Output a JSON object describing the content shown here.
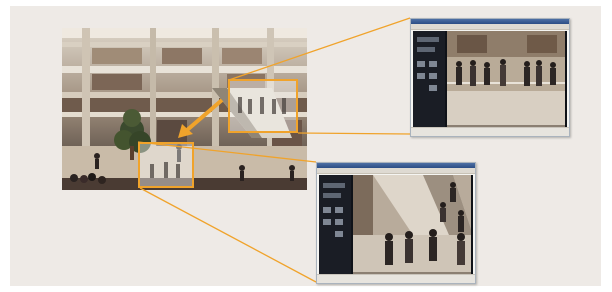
{
  "figure": {
    "accent_color": "#f0a32b",
    "background_color": "#eeeae6"
  },
  "scene": {
    "icon": "shopping-mall-atrium-photo"
  },
  "viewer_windows": [
    {
      "id": "upper-viewer",
      "icon": "monitoring-software-window"
    },
    {
      "id": "lower-viewer",
      "icon": "monitoring-software-window"
    }
  ]
}
